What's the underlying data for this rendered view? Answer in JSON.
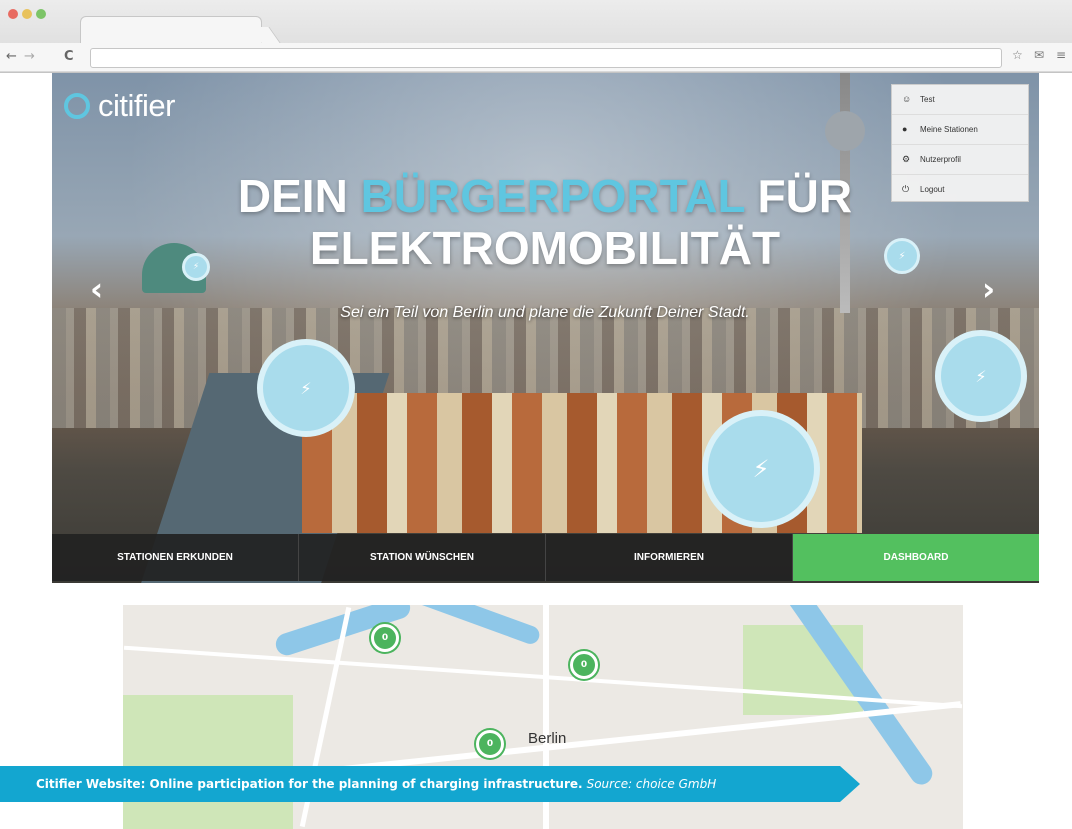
{
  "browser": {
    "nav_back": "←",
    "nav_forward": "→",
    "reload": "C",
    "url": ""
  },
  "brand": {
    "name": "citifier",
    "accent_color": "#5fc6e0"
  },
  "hero": {
    "headline_part1": "DEIN ",
    "headline_accent": "BÜRGERPORTAL",
    "headline_part2": " FÜR",
    "headline_line2": "ELEKTROMOBILITÄT",
    "subheadline": "Sei ein Teil von Berlin und plane die Zukunft Deiner Stadt.",
    "prev_arrow": "‹",
    "next_arrow": "›"
  },
  "user_menu": {
    "items": [
      {
        "icon": "user-avatar-icon",
        "label": "Test"
      },
      {
        "icon": "person-icon",
        "label": "Meine Stationen"
      },
      {
        "icon": "settings-icon",
        "label": "Nutzerprofil"
      },
      {
        "icon": "power-icon",
        "label": "Logout"
      }
    ]
  },
  "navbar": {
    "items": [
      "STATIONEN ERKUNDEN",
      "STATION WÜNSCHEN",
      "INFORMIEREN",
      "DASHBOARD"
    ],
    "active_index": 3,
    "active_color": "#53c05f"
  },
  "map": {
    "city_label": "Berlin",
    "marker_labels": [
      "0",
      "0",
      "0"
    ]
  },
  "caption": {
    "bold_text": "Citifier Website: Online participation for the planning of charging infrastructure.",
    "source_text": "Source: choice GmbH",
    "background_color": "#13a6d0"
  }
}
